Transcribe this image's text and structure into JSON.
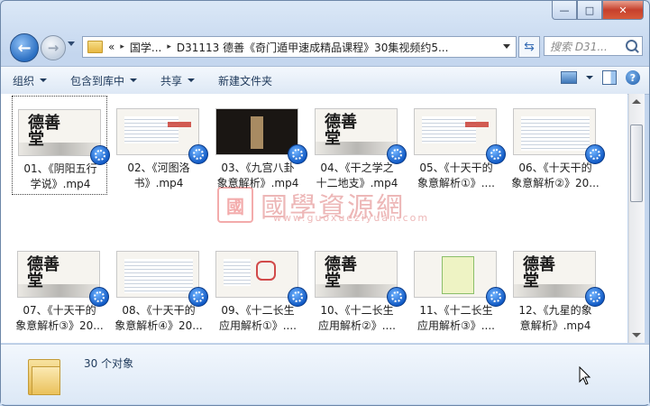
{
  "window": {
    "caption_buttons": {
      "minimize": "—",
      "maximize": "□",
      "close": "✕"
    }
  },
  "navigation": {
    "back_glyph": "←",
    "forward_glyph": "→",
    "address": {
      "prefix": "«",
      "crumbs": [
        "国学...",
        "D31113 德善《奇门遁甲速成精品课程》30集视频约5..."
      ],
      "separator": "▸"
    },
    "refresh_glyph": "⇆",
    "search_placeholder": "搜索 D31..."
  },
  "toolbar": {
    "organize": "组织",
    "include_in_library": "包含到库中",
    "share": "共享",
    "new_folder": "新建文件夹",
    "help_glyph": "?"
  },
  "files": [
    {
      "label": "01、《阴阳五行\n学说》.mp4",
      "thumb": "ink",
      "selected": true
    },
    {
      "label": "02、《河图洛\n书》.mp4",
      "thumb": "lecture"
    },
    {
      "label": "03、《九宫八卦\n象意解析》.mp4",
      "thumb": "dark"
    },
    {
      "label": "04、《干之学之\n十二地支》.mp4",
      "thumb": "ink"
    },
    {
      "label": "05、《十天干的\n象意解析①》....",
      "thumb": "lecture"
    },
    {
      "label": "06、《十天干的\n象意解析②》20...",
      "thumb": "doc"
    },
    {
      "label": "07、《十天干的\n象意解析③》20...",
      "thumb": "ink"
    },
    {
      "label": "08、《十天干的\n象意解析④》20...",
      "thumb": "doc"
    },
    {
      "label": "09、《十二长生\n应用解析①》....",
      "thumb": "hex"
    },
    {
      "label": "10、《十二长生\n应用解析②》....",
      "thumb": "ink"
    },
    {
      "label": "11、《十二长生\n应用解析③》....",
      "thumb": "grid"
    },
    {
      "label": "12、《九星的象\n意解析》.mp4",
      "thumb": "ink"
    }
  ],
  "thumb_text": {
    "ink": "德善\n堂"
  },
  "watermark": {
    "seal": "國",
    "title": "國學資源網",
    "url": "www.guoxueziyuan.com"
  },
  "details": {
    "count": "30 个对象"
  },
  "colors": {
    "accent": "#2b6fc2",
    "badge": "#0d56c2",
    "selection": "#444444"
  }
}
